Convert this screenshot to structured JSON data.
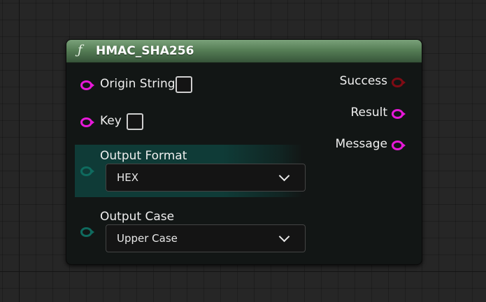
{
  "node": {
    "icon": "function-icon",
    "title": "HMAC_SHA256",
    "header_color": "#5e8a5f"
  },
  "inputs": [
    {
      "label": "Origin String",
      "pin_color": "#e619d8",
      "checked": false
    },
    {
      "label": "Key",
      "pin_color": "#e619d8",
      "checked": false
    }
  ],
  "enums": [
    {
      "label": "Output Format",
      "value": "HEX",
      "pin_color": "#0f6a5e",
      "highlighted": true
    },
    {
      "label": "Output Case",
      "value": "Upper Case",
      "pin_color": "#0f6a5e",
      "highlighted": false
    }
  ],
  "outputs": [
    {
      "label": "Success",
      "pin_color": "#7f0b14"
    },
    {
      "label": "Result",
      "pin_color": "#e619d8"
    },
    {
      "label": "Message",
      "pin_color": "#e619d8"
    }
  ]
}
